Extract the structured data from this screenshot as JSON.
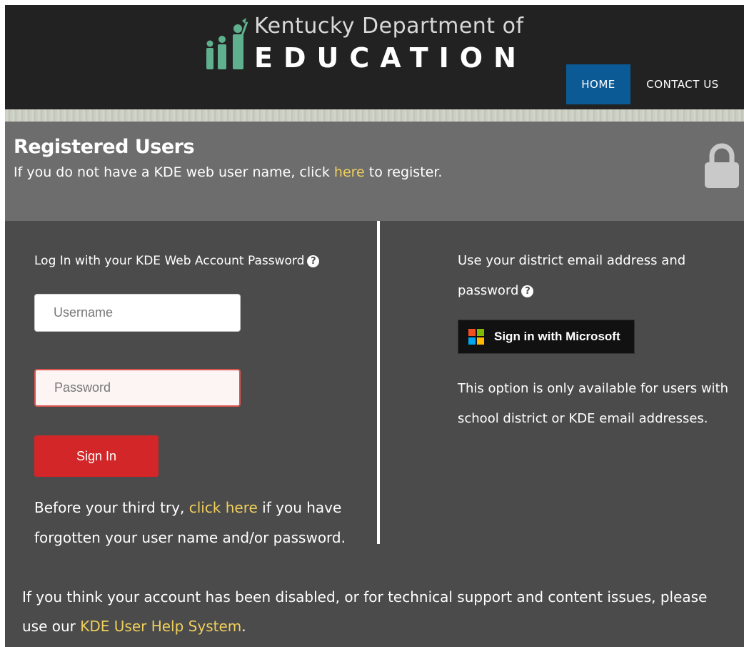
{
  "header": {
    "logo_top": "Kentucky Department of",
    "logo_bottom": "EDUCATION",
    "nav": {
      "home": "HOME",
      "contact": "CONTACT US"
    }
  },
  "band": {
    "title": "Registered Users",
    "sub_before": "If you do not have a KDE web user name, click ",
    "sub_link": "here",
    "sub_after": " to register."
  },
  "login": {
    "heading": "Log In with your KDE Web Account Password",
    "username_placeholder": "Username",
    "password_placeholder": "Password",
    "signin_label": "Sign In",
    "forgot_before": "Before your third try, ",
    "forgot_link": "click here",
    "forgot_after": " if you have forgotten your user name and/or password."
  },
  "microsoft": {
    "intro": "Use your district email address and password",
    "button_label": "Sign in with Microsoft",
    "note": "This option is only available for users with school district or KDE email addresses."
  },
  "footer": {
    "text": "If you think your account has been disabled, or for technical support and content issues, please use our ",
    "link": "KDE User Help System",
    "after": "."
  },
  "icons": {
    "help": "question-circle-icon",
    "lock": "lock-icon",
    "microsoft": "microsoft-logo-icon"
  },
  "colors": {
    "header_bg": "#222222",
    "nav_active": "#0b5a96",
    "band_bg": "#6d6d6d",
    "panel_bg": "#4b4b4b",
    "link": "#f0cf5c",
    "signin_button": "#d22628"
  }
}
